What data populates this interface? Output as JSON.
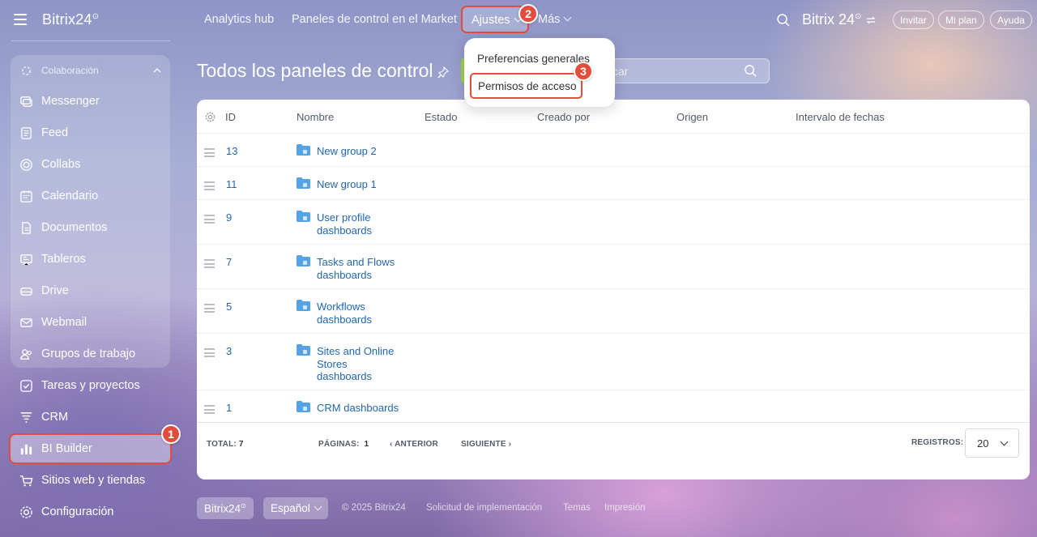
{
  "sidebar": {
    "brand": "Bitrix24",
    "brand_mark": "⊙",
    "group_header": "Colaboración",
    "items": [
      {
        "label": "Messenger",
        "icon": "messenger-icon"
      },
      {
        "label": "Feed",
        "icon": "feed-icon"
      },
      {
        "label": "Collabs",
        "icon": "collabs-icon"
      },
      {
        "label": "Calendario",
        "icon": "calendar-icon"
      },
      {
        "label": "Documentos",
        "icon": "documents-icon"
      },
      {
        "label": "Tableros",
        "icon": "boards-icon"
      },
      {
        "label": "Drive",
        "icon": "drive-icon"
      },
      {
        "label": "Webmail",
        "icon": "mail-icon"
      },
      {
        "label": "Grupos de trabajo",
        "icon": "workgroups-icon"
      },
      {
        "label": "Tareas y proyectos",
        "icon": "tasks-icon"
      },
      {
        "label": "CRM",
        "icon": "crm-icon"
      },
      {
        "label": "BI Builder",
        "icon": "bi-builder-icon",
        "active": true
      },
      {
        "label": "Sitios web y tiendas",
        "icon": "sites-icon"
      },
      {
        "label": "Configuración",
        "icon": "settings-icon"
      }
    ]
  },
  "topbar": {
    "nav": [
      "Analytics hub",
      "Paneles de control en el Market",
      "Ajustes",
      "Más"
    ],
    "brand": "Bitrix 24",
    "brand_mark": "⊙",
    "pills": [
      "Invitar",
      "Mi plan",
      "Ayuda"
    ]
  },
  "badges": [
    "1",
    "2",
    "3"
  ],
  "dropdown": {
    "items": [
      "Preferencias generales",
      "Permisos de acceso"
    ]
  },
  "page": {
    "title": "Todos los paneles de control",
    "search_placeholder": "scar"
  },
  "table": {
    "columns": [
      "ID",
      "Nombre",
      "Estado",
      "Creado por",
      "Origen",
      "Intervalo de fechas"
    ],
    "rows": [
      {
        "id": "13",
        "name": "New group 2"
      },
      {
        "id": "11",
        "name": "New group 1"
      },
      {
        "id": "9",
        "name": "User profile dashboards"
      },
      {
        "id": "7",
        "name": "Tasks and Flows dashboards"
      },
      {
        "id": "5",
        "name": "Workflows dashboards"
      },
      {
        "id": "3",
        "name": "Sites and Online Stores dashboards"
      },
      {
        "id": "1",
        "name": "CRM dashboards"
      }
    ],
    "footer": {
      "total_label": "TOTAL:",
      "total_value": "7",
      "pages_label": "PÁGINAS:",
      "pages_value": "1",
      "prev": "ANTERIOR",
      "next": "SIGUIENTE",
      "records_label": "REGISTROS:",
      "records_value": "20"
    }
  },
  "bottom_bar": {
    "brand": "Bitrix24",
    "brand_mark": "⊙",
    "language": "Español",
    "copyright": "© 2025 Bitrix24",
    "links": [
      "Solicitud de implementación",
      "Temas",
      "Impresión"
    ]
  },
  "colors": {
    "accent_red": "#e34d3d",
    "link_blue": "#2067b0",
    "folder_blue": "#55a3e6",
    "create_green": "#9dd34b"
  }
}
